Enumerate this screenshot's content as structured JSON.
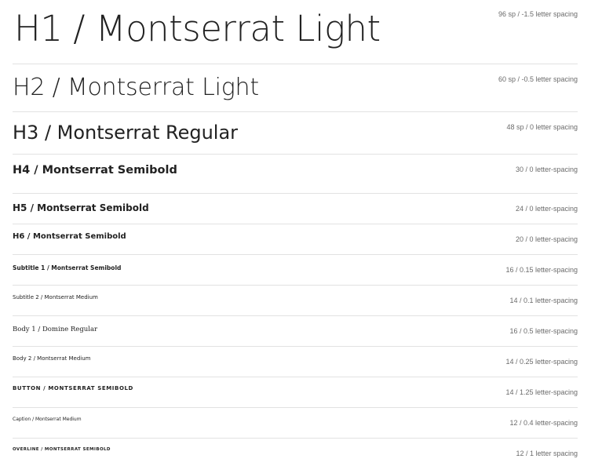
{
  "type_scale": {
    "h1": {
      "label": "H1 / Montserrat Light",
      "spec": "96 sp / -1.5 letter spacing"
    },
    "h2": {
      "label": "H2 / Montserrat Light",
      "spec": "60 sp / -0.5 letter spacing"
    },
    "h3": {
      "label": "H3 / Montserrat Regular",
      "spec": "48 sp / 0 letter spacing"
    },
    "h4": {
      "label": "H4 / Montserrat Semibold",
      "spec": "30 / 0 letter-spacing"
    },
    "h5": {
      "label": "H5 / Montserrat Semibold",
      "spec": "24 / 0 letter-spacing"
    },
    "h6": {
      "label": "H6 / Montserrat Semibold",
      "spec": "20 / 0 letter-spacing"
    },
    "subtitle1": {
      "label": "Subtitle 1 / Montserrat Semibold",
      "spec": "16 / 0.15 letter-spacing"
    },
    "subtitle2": {
      "label": "Subtitle 2 / Montserrat Medium",
      "spec": "14 / 0.1 letter-spacing"
    },
    "body1": {
      "label": "Body 1 / Domine Regular",
      "spec": "16 / 0.5 letter-spacing"
    },
    "body2": {
      "label": "Body 2 / Montserrat Medium",
      "spec": "14 / 0.25 letter-spacing"
    },
    "button": {
      "label": "BUTTON / MONTSERRAT SEMIBOLD",
      "spec": "14 / 1.25 letter-spacing"
    },
    "caption": {
      "label": "Caption / Montserrat Medium",
      "spec": "12 / 0.4 letter-spacing"
    },
    "overline": {
      "label": "OVERLINE / MONTSERRAT SEMIBOLD",
      "spec": "12 / 1 letter spacing"
    }
  },
  "colors": {
    "text": "#222222",
    "spec_text": "#6b6b6b",
    "divider": "#e2e2e2",
    "background": "#ffffff"
  }
}
